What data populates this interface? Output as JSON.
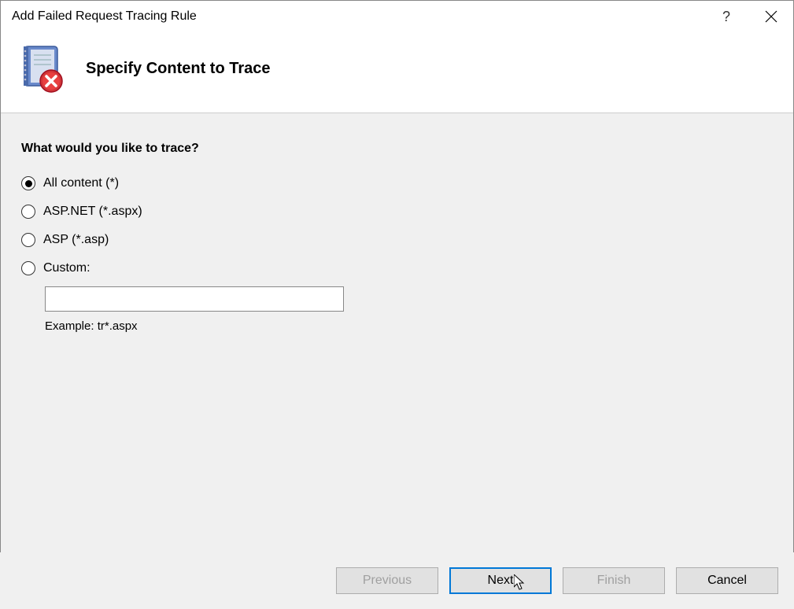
{
  "titlebar": {
    "title": "Add Failed Request Tracing Rule",
    "help_label": "?"
  },
  "header": {
    "heading": "Specify Content to Trace"
  },
  "content": {
    "prompt": "What would you like to trace?",
    "options": {
      "all_content": "All content (*)",
      "aspnet": "ASP.NET (*.aspx)",
      "asp": "ASP (*.asp)",
      "custom": "Custom:"
    },
    "custom_value": "",
    "example_text": "Example: tr*.aspx",
    "selected": "all_content"
  },
  "buttons": {
    "previous": "Previous",
    "next": "Next",
    "finish": "Finish",
    "cancel": "Cancel"
  }
}
